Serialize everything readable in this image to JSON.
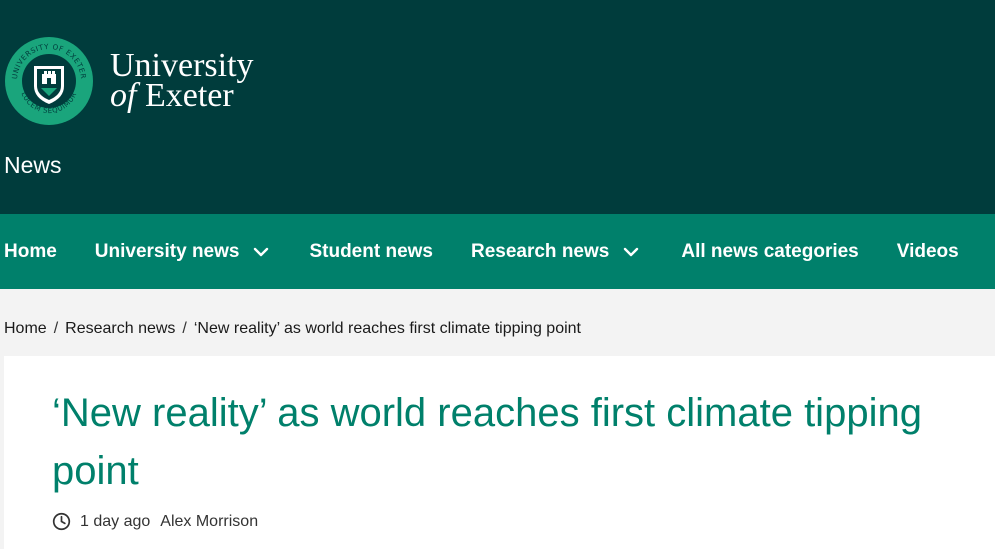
{
  "brand": {
    "line1": "University",
    "line2_italic": "of",
    "line2_plain": "Exeter",
    "seal_ring_top": "UNIVERSITY OF EXETER",
    "seal_ring_bottom": "LUCEM SEQUIMUR"
  },
  "header": {
    "section_title": "News"
  },
  "nav": {
    "items": [
      {
        "label": "Home"
      },
      {
        "label": "University news"
      },
      {
        "label": "Student news"
      },
      {
        "label": "Research news"
      },
      {
        "label": "All news categories"
      },
      {
        "label": "Videos"
      }
    ]
  },
  "breadcrumb": {
    "items": [
      "Home",
      "Research news",
      "‘New reality’ as world reaches first climate tipping point"
    ],
    "separator": "/"
  },
  "article": {
    "title": "‘New reality’ as world reaches first climate tipping point",
    "time": "1 day ago",
    "author": "Alex Morrison"
  },
  "colors": {
    "header_bg": "#003c3c",
    "nav_bg": "#00806b",
    "title_color": "#00806b",
    "seal_green": "#1aa57c"
  },
  "icons": [
    "university-seal-icon",
    "chevron-down-icon",
    "clock-icon"
  ]
}
